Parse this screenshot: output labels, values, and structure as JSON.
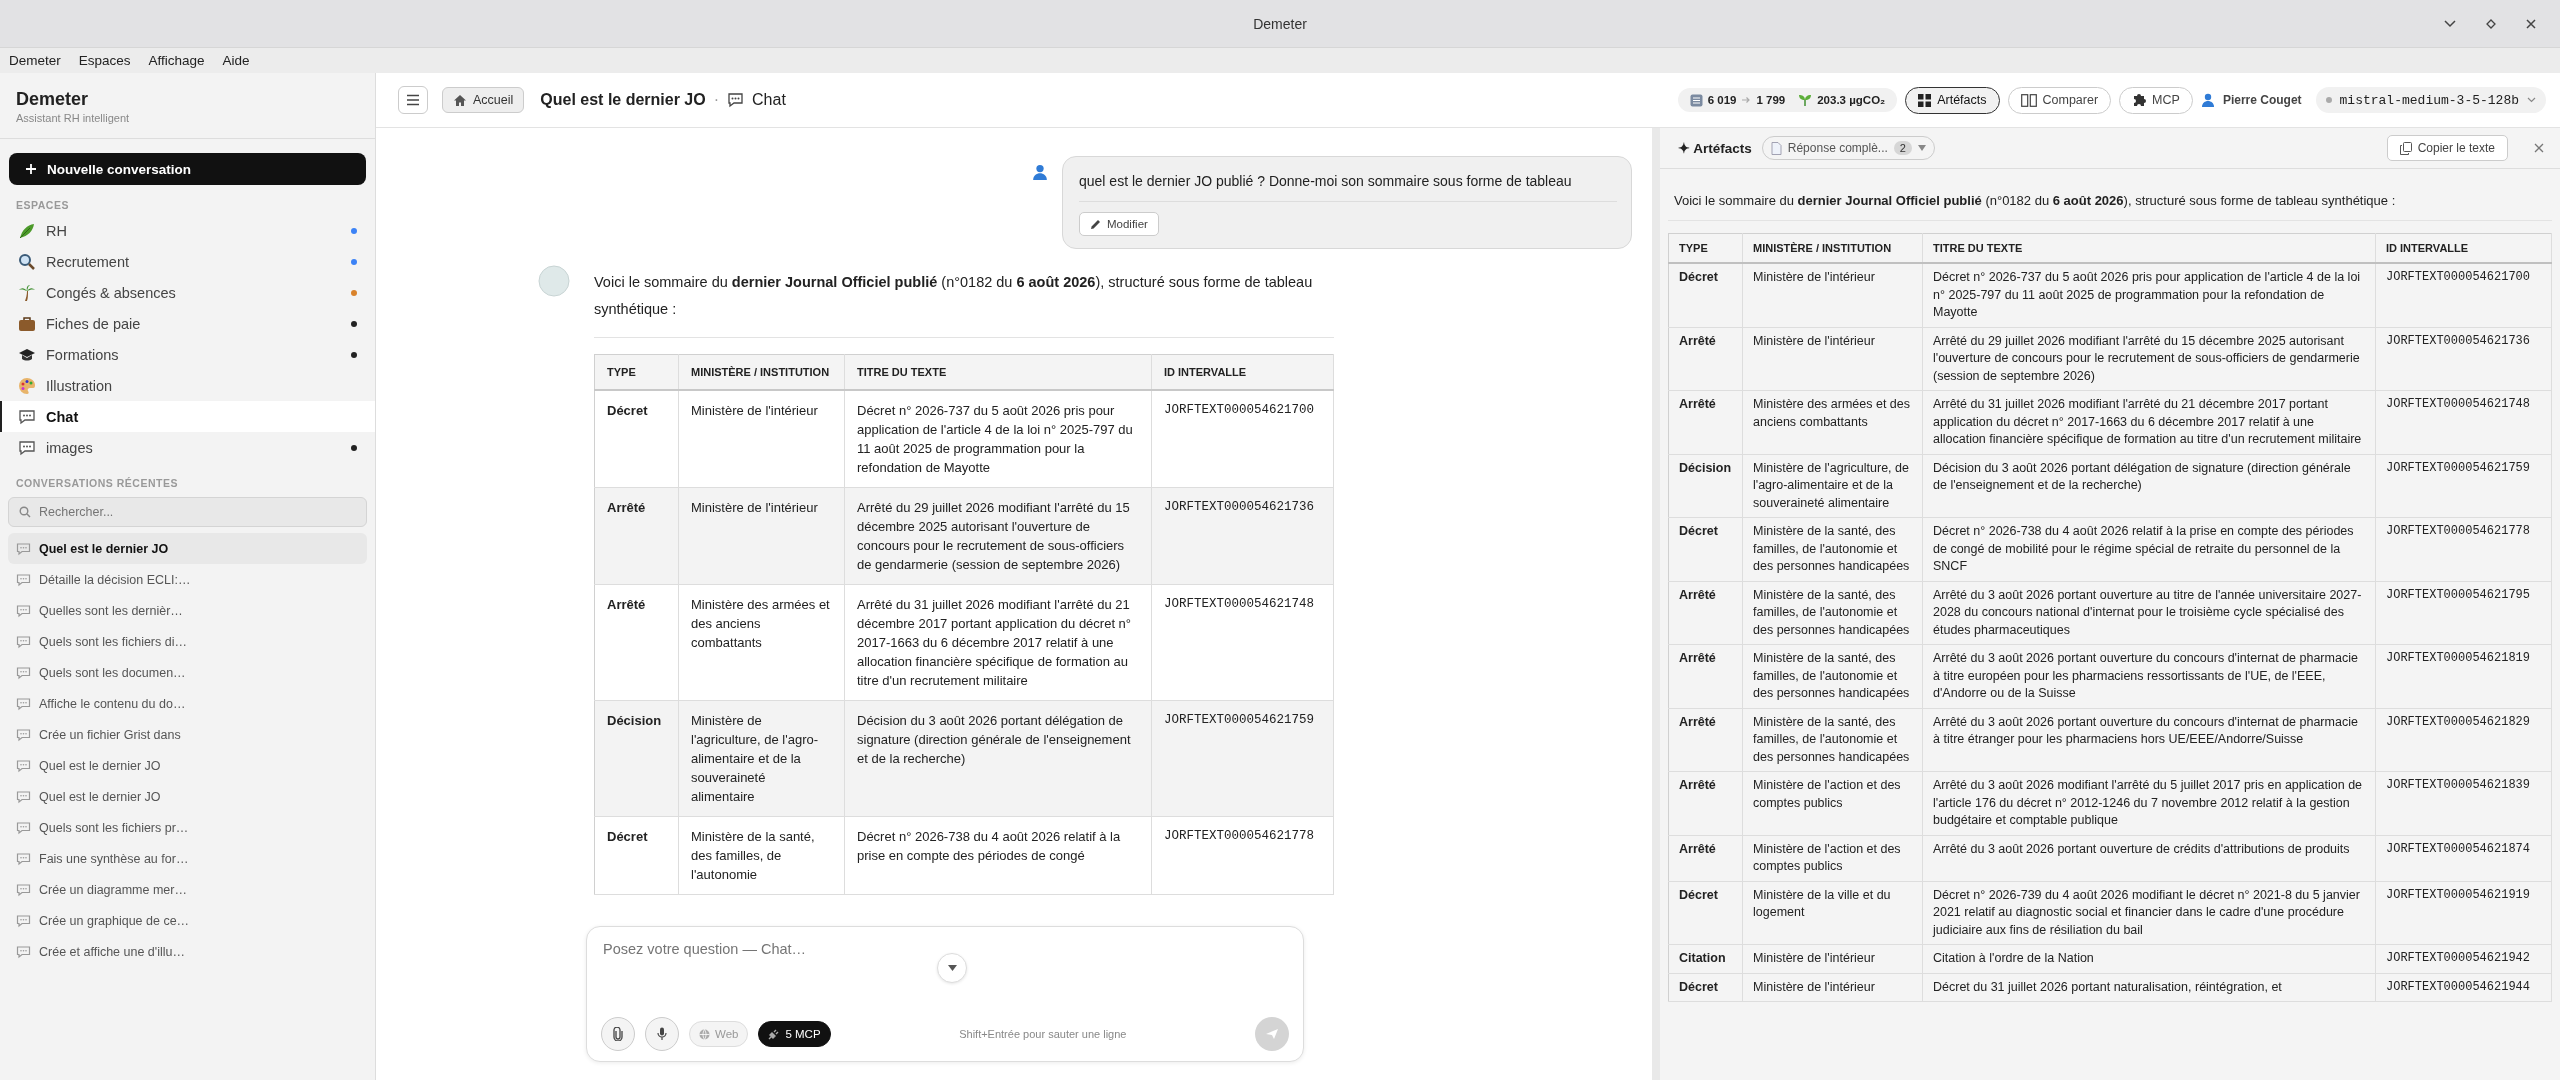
{
  "window": {
    "title": "Demeter"
  },
  "menu": [
    "Demeter",
    "Espaces",
    "Affichage",
    "Aide"
  ],
  "sidebar": {
    "brand": "Demeter",
    "tagline": "Assistant RH intelligent",
    "new_button": "Nouvelle conversation",
    "spaces_heading": "ESPACES",
    "spaces": [
      {
        "label": "RH",
        "selected": false,
        "color": "#3b82f6"
      },
      {
        "label": "Recrutement",
        "selected": false,
        "color": "#3b82f6"
      },
      {
        "label": "Congés & absences",
        "selected": false,
        "color": "#d9822b"
      },
      {
        "label": "Fiches de paie",
        "selected": false,
        "color": "#222222"
      },
      {
        "label": "Formations",
        "selected": false,
        "color": "#222222"
      },
      {
        "label": "Illustration",
        "selected": false
      },
      {
        "label": "Chat",
        "selected": true
      },
      {
        "label": "images",
        "selected": false,
        "color": "#222222"
      }
    ],
    "recent_heading": "CONVERSATIONS RÉCENTES",
    "search": {
      "placeholder": "Rechercher..."
    },
    "recent": [
      {
        "label": "Quel est le dernier JO",
        "selected": true
      },
      {
        "label": "Détaille la décision ECLI:…",
        "selected": false
      },
      {
        "label": "Quelles sont les dernièr…",
        "selected": false
      },
      {
        "label": "Quels sont les fichiers di…",
        "selected": false
      },
      {
        "label": "Quels sont les documen…",
        "selected": false
      },
      {
        "label": "Affiche le contenu du do…",
        "selected": false
      },
      {
        "label": "Crée un fichier Grist dans",
        "selected": false
      },
      {
        "label": "Quel est le dernier JO",
        "selected": false
      },
      {
        "label": "Quel est le dernier JO",
        "selected": false
      },
      {
        "label": "Quels sont les fichiers pr…",
        "selected": false
      },
      {
        "label": "Fais une synthèse au for…",
        "selected": false
      },
      {
        "label": "Crée un diagramme mer…",
        "selected": false
      },
      {
        "label": "Crée un graphique de ce…",
        "selected": false
      },
      {
        "label": "Crée et affiche une d'illu…",
        "selected": false
      }
    ]
  },
  "header": {
    "home": "Accueil",
    "title": "Quel est le dernier JO",
    "separator": "·",
    "space": "Chat",
    "tokens_in": "6 019",
    "tokens_out": "1 799",
    "carbon": "203.3 µgCO₂",
    "tabs": [
      {
        "label": "Artéfacts",
        "selected": true
      },
      {
        "label": "Comparer",
        "selected": false
      },
      {
        "label": "MCP",
        "selected": false
      }
    ],
    "user": "Pierre Couget",
    "model": "mistral-medium-3-5-128b"
  },
  "chat": {
    "user_message": "quel est le dernier JO publié ? Donne-moi son sommaire sous forme de tableau",
    "edit_button": "Modifier",
    "answer": "Voici le sommaire du **dernier Journal Officiel publié** (n°0182 du **6 août 2026**), structuré sous forme de tableau synthétique :",
    "table": {
      "columns": [
        "TYPE",
        "MINISTÈRE / INSTITUTION",
        "TITRE DU TEXTE",
        "ID INTERVALLE"
      ],
      "rows": [
        [
          "Décret",
          "Ministère de l'intérieur",
          "Décret n° 2026-737 du 5 août 2026 pris pour application de l'article 4 de la loi n° 2025-797 du 11 août 2025 de programmation pour la refondation de Mayotte",
          "JORFTEXT000054621700"
        ],
        [
          "Arrêté",
          "Ministère de l'intérieur",
          "Arrêté du 29 juillet 2026 modifiant l'arrêté du 15 décembre 2025 autorisant l'ouverture de concours pour le recrutement de sous-officiers de gendarmerie (session de septembre 2026)",
          "JORFTEXT000054621736"
        ],
        [
          "Arrêté",
          "Ministère des armées et des anciens combattants",
          "Arrêté du 31 juillet 2026 modifiant l'arrêté du 21 décembre 2017 portant application du décret n° 2017-1663 du 6 décembre 2017 relatif à une allocation financière spécifique de formation au titre d'un recrutement militaire",
          "JORFTEXT000054621748"
        ],
        [
          "Décision",
          "Ministère de l'agriculture, de l'agro-alimentaire et de la souveraineté alimentaire",
          "Décision du 3 août 2026 portant délégation de signature (direction générale de l'enseignement et de la recherche)",
          "JORFTEXT000054621759"
        ],
        [
          "Décret",
          "Ministère de la santé, des familles, de l'autonomie",
          "Décret n° 2026-738 du 4 août 2026 relatif à la prise en compte des périodes de congé",
          "JORFTEXT000054621778"
        ]
      ]
    }
  },
  "composer": {
    "placeholder": "Posez votre question — Chat…",
    "web": {
      "label": "Web",
      "on": false
    },
    "mcp": {
      "label": "5 MCP",
      "on": true
    },
    "hint": "Shift+Entrée pour sauter une ligne"
  },
  "artifacts": {
    "title": "✦ Artéfacts",
    "picker": "Réponse complè...",
    "count": "2",
    "copy_button": "Copier le texte",
    "intro": "Voici le sommaire du **dernier Journal Officiel publié** (n°0182 du **6 août 2026**), structuré sous forme de tableau synthétique :",
    "table": {
      "columns": [
        "TYPE",
        "MINISTÈRE / INSTITUTION",
        "TITRE DU TEXTE",
        "ID INTERVALLE"
      ],
      "rows": [
        [
          "Décret",
          "Ministère de l'intérieur",
          "Décret n° 2026-737 du 5 août 2026 pris pour application de l'article 4 de la loi n° 2025-797 du 11 août 2025 de programmation pour la refondation de Mayotte",
          "JORFTEXT000054621700"
        ],
        [
          "Arrêté",
          "Ministère de l'intérieur",
          "Arrêté du 29 juillet 2026 modifiant l'arrêté du 15 décembre 2025 autorisant l'ouverture de concours pour le recrutement de sous-officiers de gendarmerie (session de septembre 2026)",
          "JORFTEXT000054621736"
        ],
        [
          "Arrêté",
          "Ministère des armées et des anciens combattants",
          "Arrêté du 31 juillet 2026 modifiant l'arrêté du 21 décembre 2017 portant application du décret n° 2017-1663 du 6 décembre 2017 relatif à une allocation financière spécifique de formation au titre d'un recrutement militaire",
          "JORFTEXT000054621748"
        ],
        [
          "Décision",
          "Ministère de l'agriculture, de l'agro-alimentaire et de la souveraineté alimentaire",
          "Décision du 3 août 2026 portant délégation de signature (direction générale de l'enseignement et de la recherche)",
          "JORFTEXT000054621759"
        ],
        [
          "Décret",
          "Ministère de la santé, des familles, de l'autonomie et des personnes handicapées",
          "Décret n° 2026-738 du 4 août 2026 relatif à la prise en compte des périodes de congé de mobilité pour le régime spécial de retraite du personnel de la SNCF",
          "JORFTEXT000054621778"
        ],
        [
          "Arrêté",
          "Ministère de la santé, des familles, de l'autonomie et des personnes handicapées",
          "Arrêté du 3 août 2026 portant ouverture au titre de l'année universitaire 2027-2028 du concours national d'internat pour le troisième cycle spécialisé des études pharmaceutiques",
          "JORFTEXT000054621795"
        ],
        [
          "Arrêté",
          "Ministère de la santé, des familles, de l'autonomie et des personnes handicapées",
          "Arrêté du 3 août 2026 portant ouverture du concours d'internat de pharmacie à titre européen pour les pharmaciens ressortissants de l'UE, de l'EEE, d'Andorre ou de la Suisse",
          "JORFTEXT000054621819"
        ],
        [
          "Arrêté",
          "Ministère de la santé, des familles, de l'autonomie et des personnes handicapées",
          "Arrêté du 3 août 2026 portant ouverture du concours d'internat de pharmacie à titre étranger pour les pharmaciens hors UE/EEE/Andorre/Suisse",
          "JORFTEXT000054621829"
        ],
        [
          "Arrêté",
          "Ministère de l'action et des comptes publics",
          "Arrêté du 3 août 2026 modifiant l'arrêté du 5 juillet 2017 pris en application de l'article 176 du décret n° 2012-1246 du 7 novembre 2012 relatif à la gestion budgétaire et comptable publique",
          "JORFTEXT000054621839"
        ],
        [
          "Arrêté",
          "Ministère de l'action et des comptes publics",
          "Arrêté du 3 août 2026 portant ouverture de crédits d'attributions de produits",
          "JORFTEXT000054621874"
        ],
        [
          "Décret",
          "Ministère de la ville et du logement",
          "Décret n° 2026-739 du 4 août 2026 modifiant le décret n° 2021-8 du 5 janvier 2021 relatif au diagnostic social et financier dans le cadre d'une procédure judiciaire aux fins de résiliation du bail",
          "JORFTEXT000054621919"
        ],
        [
          "Citation",
          "Ministère de l'intérieur",
          "Citation à l'ordre de la Nation",
          "JORFTEXT000054621942"
        ],
        [
          "Décret",
          "Ministère de l'intérieur",
          "Décret du 31 juillet 2026 portant naturalisation, réintégration, et",
          "JORFTEXT000054621944"
        ]
      ]
    }
  }
}
